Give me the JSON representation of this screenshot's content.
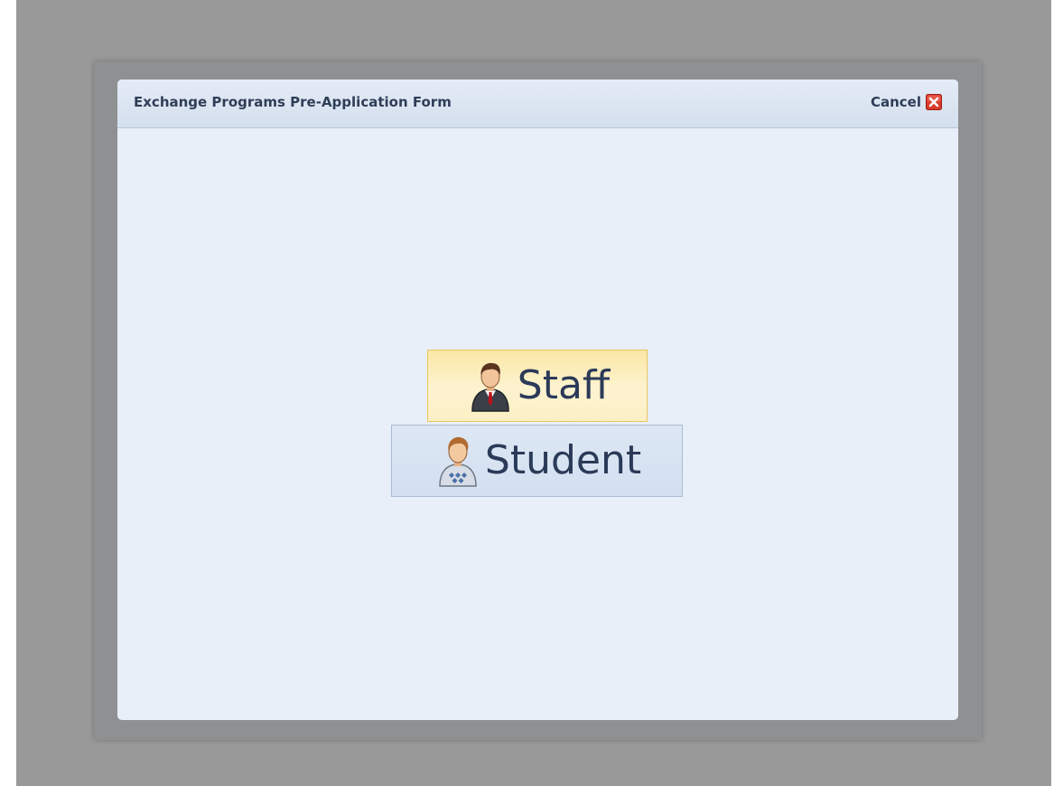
{
  "dialog": {
    "title": "Exchange Programs Pre-Application Form",
    "cancel_label": "Cancel"
  },
  "choices": {
    "staff_label": "Staff",
    "student_label": "Student"
  },
  "icons": {
    "close": "close-icon",
    "staff": "staff-person-icon",
    "student": "student-person-icon"
  },
  "colors": {
    "close_red": "#d93a2b",
    "staff_highlight": "#fbe7a7",
    "student_bg": "#d3e0f0",
    "text": "#2b3a58"
  }
}
